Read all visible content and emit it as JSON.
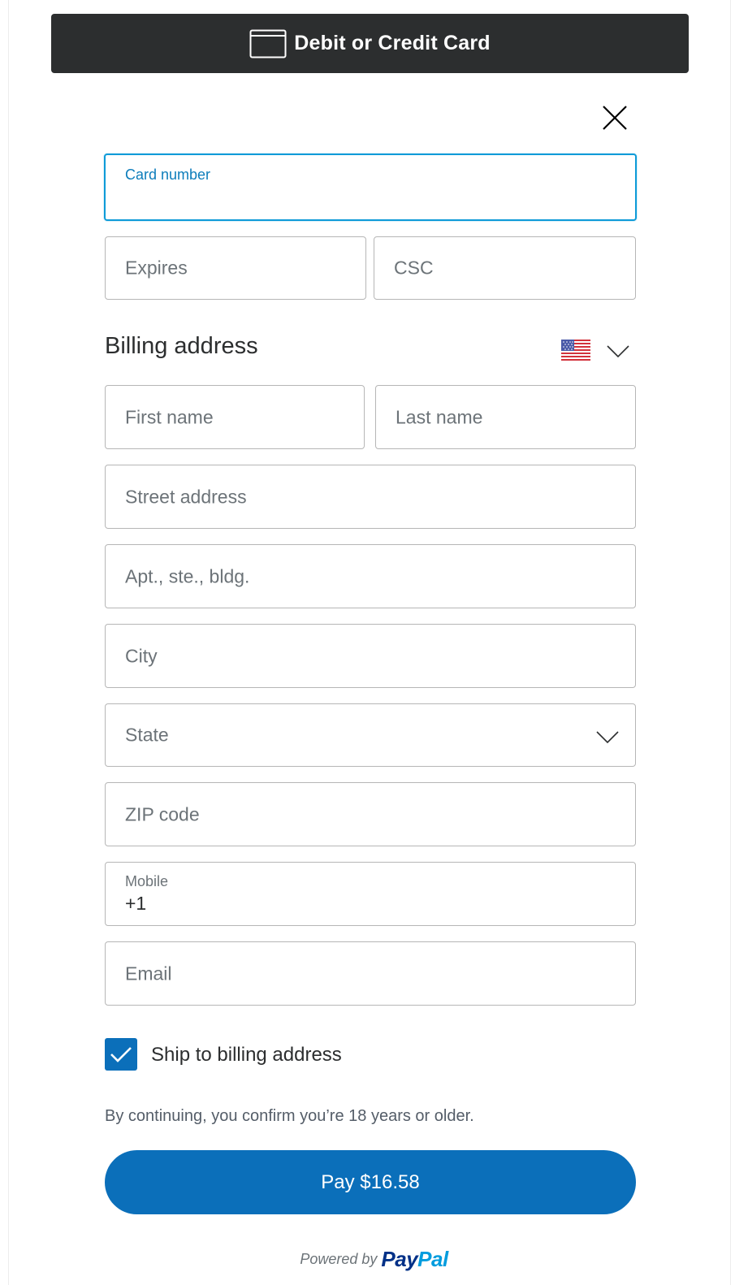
{
  "header": {
    "title": "Debit or Credit Card",
    "icon": "credit-card-icon"
  },
  "close": {
    "icon": "close-icon"
  },
  "card": {
    "number_label": "Card number",
    "expires_placeholder": "Expires",
    "csc_placeholder": "CSC"
  },
  "billing": {
    "title": "Billing address",
    "country_flag": "us-flag-icon",
    "first_name_placeholder": "First name",
    "last_name_placeholder": "Last name",
    "street_placeholder": "Street address",
    "apt_placeholder": "Apt., ste., bldg.",
    "city_placeholder": "City",
    "state_placeholder": "State",
    "zip_placeholder": "ZIP code",
    "mobile_label": "Mobile",
    "mobile_value": "+1",
    "email_placeholder": "Email"
  },
  "shipping": {
    "checkbox_checked": true,
    "label": "Ship to billing address"
  },
  "confirm_text": "By continuing, you confirm you’re 18 years or older.",
  "pay_button": {
    "label": "Pay $16.58"
  },
  "footer": {
    "powered_by": "Powered by",
    "brand_pay": "Pay",
    "brand_pal": "Pal"
  },
  "colors": {
    "header_bg": "#2c2e2f",
    "focus_border": "#0e9bd8",
    "primary_blue": "#0b6fba",
    "paypal_dark": "#003087",
    "paypal_light": "#009cde"
  }
}
